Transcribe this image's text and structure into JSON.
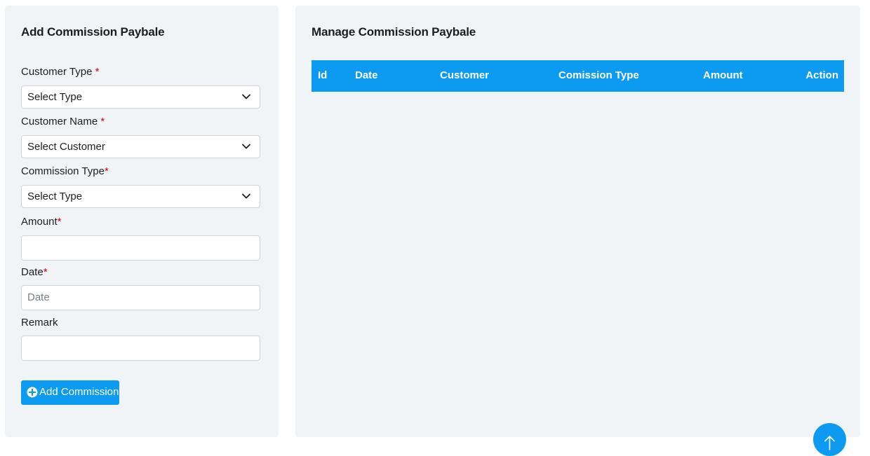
{
  "left": {
    "title": "Add Commission Paybale",
    "fields": [
      {
        "label": "Customer Type ",
        "required": "*",
        "kind": "select",
        "value": "Select Type"
      },
      {
        "label": "Customer Name ",
        "required": "*",
        "kind": "select",
        "value": "Select Customer"
      },
      {
        "label": "Commission Type",
        "required": "*",
        "kind": "select",
        "value": "Select Type"
      },
      {
        "label": "Amount",
        "required": "*",
        "kind": "input",
        "value": ""
      },
      {
        "label": "Date",
        "required": "*",
        "kind": "input",
        "value": "",
        "placeholder": "Date"
      },
      {
        "label": "Remark",
        "required": "",
        "kind": "input",
        "value": ""
      }
    ],
    "button": {
      "label": "Add Commission",
      "icon": "plus-circle-icon"
    }
  },
  "right": {
    "title": "Manage Commission Paybale",
    "table": {
      "columns": [
        "Id",
        "Date",
        "Customer",
        "Comission Type",
        "Amount",
        "Action"
      ],
      "rows": []
    }
  },
  "scroll_top": {
    "icon": "arrow-up-icon"
  },
  "colors": {
    "accent": "#0d9af1",
    "panel_bg": "#f1f4f7",
    "required": "#d0021b"
  }
}
